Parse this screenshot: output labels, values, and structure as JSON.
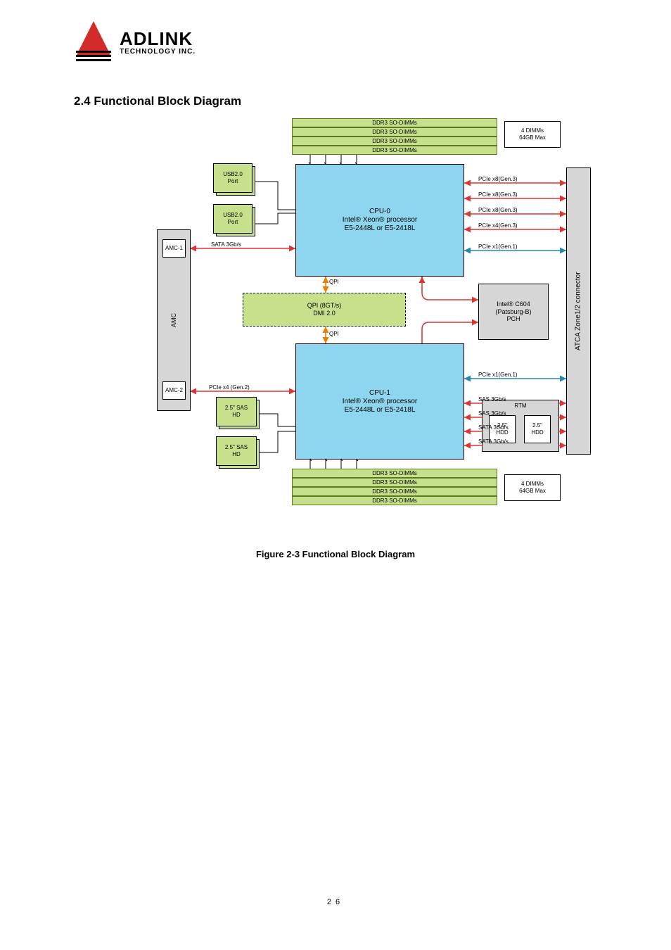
{
  "logo": {
    "title": "ADLINK",
    "subtitle": "TECHNOLOGY INC."
  },
  "section_title": "2.4 Functional Block Diagram",
  "figure_caption": "Figure 2-3 Functional Block Diagram",
  "page_number": "26",
  "top_ddr": {
    "b0": "DDR3 SO-DIMMs",
    "b1": "DDR3 SO-DIMMs",
    "b2": "DDR3 SO-DIMMs",
    "b3": "DDR3 SO-DIMMs",
    "note": "4 DIMMs\n64GB Max"
  },
  "bottom_ddr": {
    "b0": "DDR3 SO-DIMMs",
    "b1": "DDR3 SO-DIMMs",
    "b2": "DDR3 SO-DIMMs",
    "b3": "DDR3 SO-DIMMs",
    "note": "4 DIMMs\n64GB Max"
  },
  "cpu0": "CPU-0\nIntel® Xeon® processor\nE5-2448L or E5-2418L",
  "cpu1": "CPU-1\nIntel® Xeon® processor\nE5-2448L or E5-2418L",
  "pch": "Intel® C604\n(Patsburg-B)\nPCH",
  "qpi_top": "QPI (8GT/s)",
  "dmi": "DMI 2.0",
  "qpi_mid": "QPI",
  "atca": "ATCA Zone1/2 connector",
  "amc": {
    "title": "AMC",
    "box1": "AMC-1",
    "box2": "AMC-2"
  },
  "usb0": {
    "l1": "USB2.0",
    "l2": "Port"
  },
  "usb1": {
    "l1": "USB2.0",
    "l2": "Port"
  },
  "sas0": "2.5\" SAS\nHD",
  "sas1": "2.5\" SAS\nHD",
  "rtm": {
    "title": "RTM",
    "hd1": "2.5\"\nHDD",
    "hd2": "2.5\"\nHDD"
  },
  "bus": {
    "top_pcie_x8_1": "PCIe x8(Gen.3)",
    "top_pcie_x8_2": "PCIe x8(Gen.3)",
    "top_pcie_x8_3": "PCIe x8(Gen.3)",
    "top_pcie_x4": "PCIe x4(Gen.3)",
    "top_pcie_x1": "PCIe x1(Gen.1)",
    "bot_pcie_x1": "PCIe x1(Gen.1)",
    "sas_a": "SAS 3Gb/s",
    "sas_b": "SAS 3Gb/s",
    "sata_rtm_a": "SATA 3Gb/s",
    "sata_rtm_b": "SATA 3Gb/s",
    "amc1_bus": "SATA 3Gb/s",
    "amc2_bus": "PCIe x4 (Gen.2)"
  },
  "chart_data": {
    "type": "block-diagram",
    "cpus": [
      {
        "id": "CPU-0",
        "model": "Intel® Xeon® E5-2448L / E5-2418L",
        "memory": {
          "dimms": 4,
          "type": "DDR3 SO-DIMM",
          "max_gb": 64
        }
      },
      {
        "id": "CPU-1",
        "model": "Intel® Xeon® E5-2448L / E5-2418L",
        "memory": {
          "dimms": 4,
          "type": "DDR3 SO-DIMM",
          "max_gb": 64
        }
      }
    ],
    "interconnect": {
      "cpu_cpu": "QPI",
      "cpu_pch": {
        "type": "QPI",
        "speed": "8GT/s",
        "alt": "DMI 2.0"
      }
    },
    "pch": "Intel® C604 (Patsburg-B)",
    "backplane": "ATCA Zone1/2 connector",
    "amc_slots": [
      {
        "name": "AMC-1",
        "bus": "SATA 3Gb/s"
      },
      {
        "name": "AMC-2",
        "bus": "PCIe x4 (Gen.2)"
      }
    ],
    "usb_ports": 2,
    "local_storage": [
      "2.5\" SAS HD",
      "2.5\" SAS HD"
    ],
    "rtm_storage": [
      "2.5\" HDD",
      "2.5\" HDD"
    ],
    "cpu0_buses_to_atca": [
      "PCIe x8(Gen.3)",
      "PCIe x8(Gen.3)",
      "PCIe x8(Gen.3)",
      "PCIe x4(Gen.3)",
      "PCIe x1(Gen.1)"
    ],
    "pch_buses_to_atca": [
      "PCIe x1(Gen.1)",
      "SATA 3Gb/s",
      "SATA 3Gb/s"
    ],
    "pch_buses_to_local_hd": [
      "SAS 3Gb/s",
      "SAS 3Gb/s"
    ],
    "pch_buses_to_rtm": [
      "SATA 3Gb/s",
      "SATA 3Gb/s"
    ]
  }
}
